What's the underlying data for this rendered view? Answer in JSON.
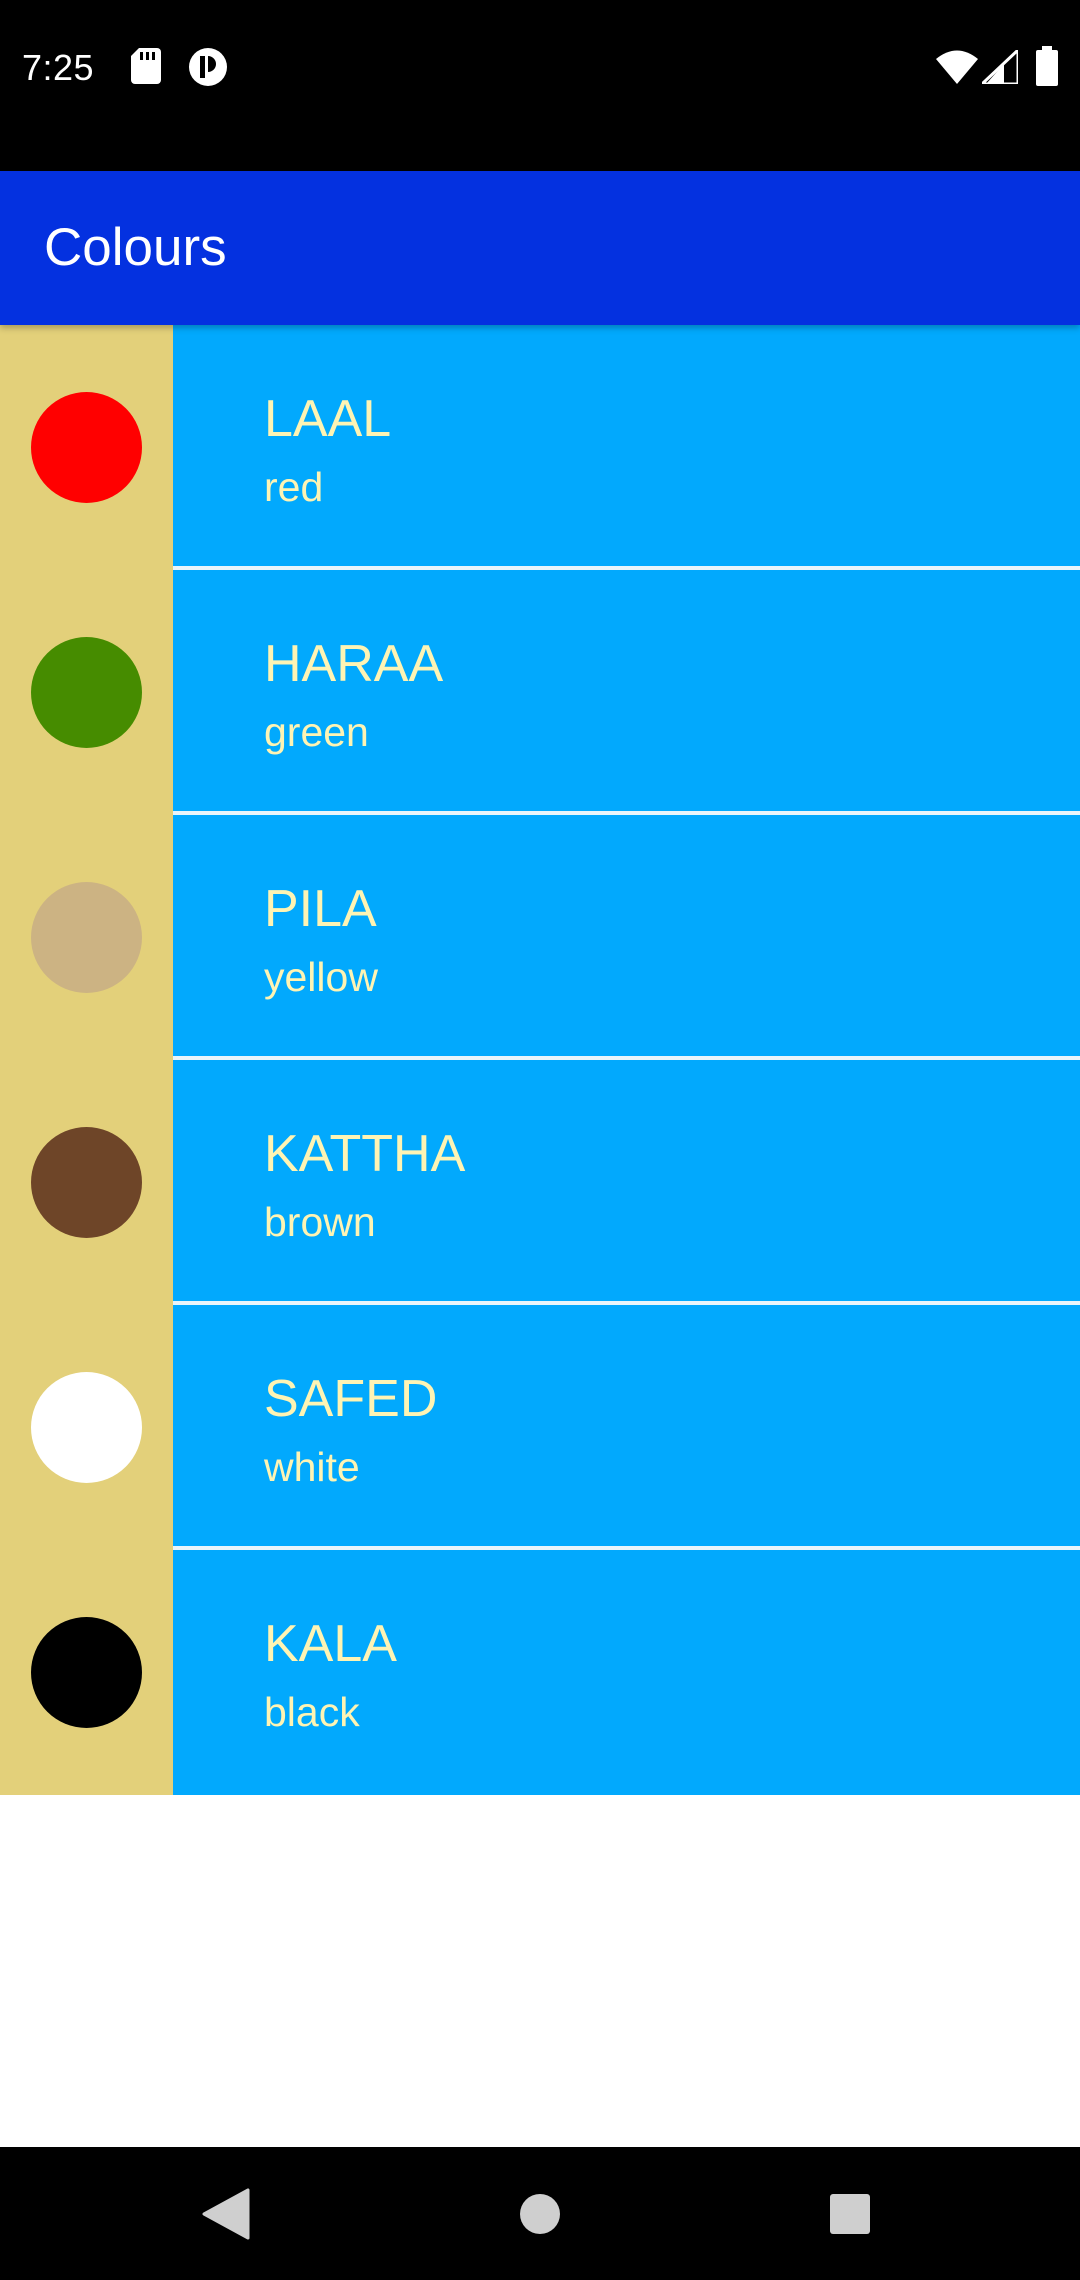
{
  "status_bar": {
    "time": "7:25",
    "icons": [
      "sd-card-icon",
      "app-notification-icon",
      "wifi-icon",
      "cell-signal-icon",
      "battery-icon"
    ]
  },
  "app_bar": {
    "title": "Colours",
    "color": "#0431e0"
  },
  "list": {
    "swatch_background": "#e3d07a",
    "item_background": "#02a9fd",
    "text_color": "#fef4b4",
    "items": [
      {
        "miwok": "LAAL",
        "english": "red",
        "swatch_color": "#ff0000"
      },
      {
        "miwok": "HARAA",
        "english": "green",
        "swatch_color": "#468c00"
      },
      {
        "miwok": "PILA",
        "english": "yellow",
        "swatch_color": "#ccb383"
      },
      {
        "miwok": "KATTHA",
        "english": "brown",
        "swatch_color": "#6e4528"
      },
      {
        "miwok": "SAFED",
        "english": "white",
        "swatch_color": "#ffffff"
      },
      {
        "miwok": "KALA",
        "english": "black",
        "swatch_color": "#000000"
      }
    ]
  },
  "nav_bar": {
    "icons": [
      "back-icon",
      "home-icon",
      "recents-icon"
    ]
  }
}
